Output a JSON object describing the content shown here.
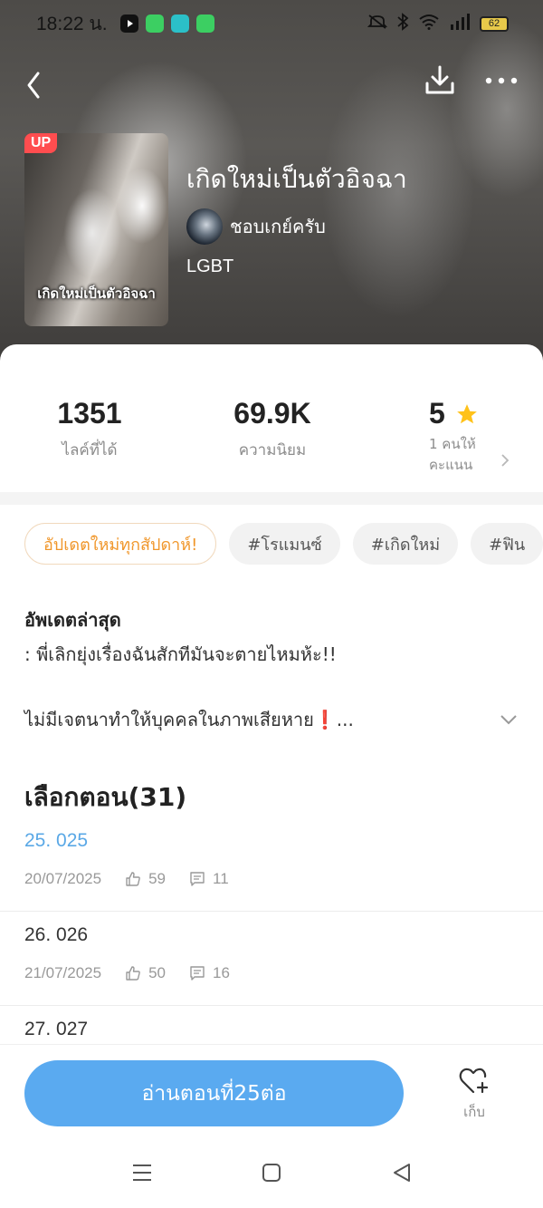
{
  "status_bar": {
    "time": "18:22 น.",
    "battery": "62",
    "app_colors": [
      "#111111",
      "#3ccf62",
      "#2bc0c8",
      "#3ccf62"
    ]
  },
  "nav": {
    "back_icon": "chevron-left-icon",
    "download_icon": "download-icon",
    "more_icon": "more-dots-icon"
  },
  "book": {
    "badge": "UP",
    "cover_title": "เกิดใหม่เป็นตัวอิจฉา",
    "title": "เกิดใหม่เป็นตัวอิจฉา",
    "author": "ชอบเกย์ครับ",
    "genre": "LGBT"
  },
  "stats": {
    "likes_value": "1351",
    "likes_label": "ไลค์ที่ได้",
    "popularity_value": "69.9K",
    "popularity_label": "ความนิยม",
    "rating_value": "5",
    "rating_label": "1 คนให้คะแนน",
    "star_color": "#ffc21a"
  },
  "tags": [
    {
      "label": "อัปเดตใหม่ทุกสัปดาห์!",
      "highlight": true
    },
    {
      "label": "#โรแมนซ์"
    },
    {
      "label": "#เกิดใหม่"
    },
    {
      "label": "#ฟิน"
    }
  ],
  "latest": {
    "title": "อัพเดตล่าสุด",
    "text": ": พี่เลิกยุ่งเรื่องฉันสักทีมันจะตายไหมห้ะ!!"
  },
  "description": "ไม่มีเจตนาทำให้บุคคลในภาพเสียหาย❗...",
  "episodes": {
    "title": "เลือกตอน(31)",
    "items": [
      {
        "title": "25. 025",
        "date": "20/07/2025",
        "likes": "59",
        "comments": "11",
        "current": true
      },
      {
        "title": "26. 026",
        "date": "21/07/2025",
        "likes": "50",
        "comments": "16"
      },
      {
        "title": "27. 027"
      }
    ]
  },
  "bottom": {
    "read_label": "อ่านตอนที่25ต่อ",
    "save_label": "เก็บ",
    "accent": "#5aaaf0"
  }
}
